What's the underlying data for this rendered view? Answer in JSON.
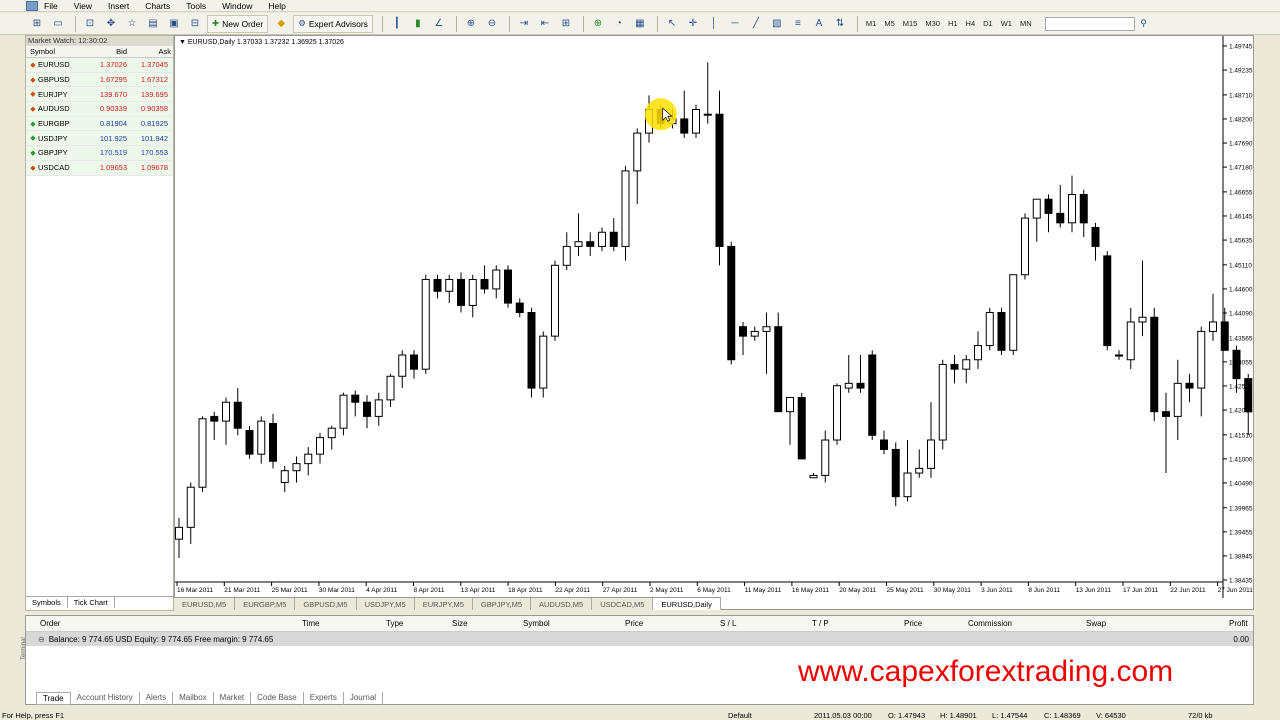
{
  "menu": [
    "File",
    "View",
    "Insert",
    "Charts",
    "Tools",
    "Window",
    "Help"
  ],
  "toolbar": {
    "new_order": "New Order",
    "expert_advisors": "Expert Advisors",
    "timeframes": [
      "M1",
      "M5",
      "M15",
      "M30",
      "H1",
      "H4",
      "D1",
      "W1",
      "MN"
    ]
  },
  "market_watch": {
    "title": "Market Watch: 12:30:02",
    "headers": {
      "symbol": "Symbol",
      "bid": "Bid",
      "ask": "Ask"
    },
    "rows": [
      {
        "symbol": "EURUSD",
        "bid": "1.37026",
        "ask": "1.37045",
        "dir": "down",
        "color": "#c81e1e"
      },
      {
        "symbol": "GBPUSD",
        "bid": "1.67295",
        "ask": "1.67312",
        "dir": "down",
        "color": "#c81e1e"
      },
      {
        "symbol": "EURJPY",
        "bid": "139.670",
        "ask": "139.695",
        "dir": "down",
        "color": "#c81e1e"
      },
      {
        "symbol": "AUDUSD",
        "bid": "0.90339",
        "ask": "0.90358",
        "dir": "down",
        "color": "#c81e1e"
      },
      {
        "symbol": "EURGBP",
        "bid": "0.81904",
        "ask": "0.81925",
        "dir": "up",
        "color": "#1a3fa8"
      },
      {
        "symbol": "USDJPY",
        "bid": "101.925",
        "ask": "101.942",
        "dir": "up",
        "color": "#1a3fa8"
      },
      {
        "symbol": "GBPJPY",
        "bid": "170.519",
        "ask": "170.553",
        "dir": "up",
        "color": "#1a3fa8"
      },
      {
        "symbol": "USDCAD",
        "bid": "1.09653",
        "ask": "1.09678",
        "dir": "down",
        "color": "#c81e1e"
      }
    ],
    "tabs": [
      "Symbols",
      "Tick Chart"
    ]
  },
  "chart": {
    "title": "EURUSD,Daily  1.37033 1.37232 1.36925 1.37026",
    "price_labels": [
      "1.49745",
      "1.49235",
      "1.48710",
      "1.48200",
      "1.47690",
      "1.47180",
      "1.46655",
      "1.46145",
      "1.45635",
      "1.45110",
      "1.44600",
      "1.44090",
      "1.43565",
      "1.43055",
      "1.42545",
      "1.42035",
      "1.41510",
      "1.41000",
      "1.40490",
      "1.39965",
      "1.39455",
      "1.38945",
      "1.38435"
    ],
    "date_labels": [
      "16 Mar 2011",
      "21 Mar 2011",
      "25 Mar 2011",
      "30 Mar 2011",
      "4 Apr 2011",
      "8 Apr 2011",
      "13 Apr 2011",
      "18 Apr 2011",
      "22 Apr 2011",
      "27 Apr 2011",
      "2 May 2011",
      "6 May 2011",
      "11 May 2011",
      "16 May 2011",
      "20 May 2011",
      "25 May 2011",
      "30 May 2011",
      "3 Jun 2011",
      "8 Jun 2011",
      "13 Jun 2011",
      "17 Jun 2011",
      "22 Jun 2011",
      "27 Jun 2011"
    ],
    "tabs": [
      "EURUSD,M5",
      "EURGBP,M5",
      "GBPUSD,M5",
      "USDJPY,M5",
      "EURJPY,M5",
      "GBPJPY,M5",
      "AUDUSD,M5",
      "USDCAD,M5",
      "EURUSD,Daily"
    ]
  },
  "chart_data": {
    "type": "candlestick",
    "symbol": "EURUSD",
    "ylim": [
      1.38435,
      1.49745
    ],
    "candles": [
      [
        1.393,
        1.3975,
        1.389,
        1.3955
      ],
      [
        1.3955,
        1.405,
        1.392,
        1.404
      ],
      [
        1.404,
        1.419,
        1.403,
        1.4185
      ],
      [
        1.419,
        1.42,
        1.414,
        1.418
      ],
      [
        1.418,
        1.423,
        1.413,
        1.422
      ],
      [
        1.422,
        1.425,
        1.415,
        1.4165
      ],
      [
        1.416,
        1.417,
        1.41,
        1.411
      ],
      [
        1.411,
        1.419,
        1.409,
        1.418
      ],
      [
        1.4175,
        1.4195,
        1.408,
        1.4095
      ],
      [
        1.405,
        1.4085,
        1.403,
        1.4075
      ],
      [
        1.4075,
        1.4105,
        1.405,
        1.409
      ],
      [
        1.409,
        1.4125,
        1.4065,
        1.411
      ],
      [
        1.411,
        1.4155,
        1.409,
        1.4145
      ],
      [
        1.4145,
        1.417,
        1.412,
        1.4165
      ],
      [
        1.4165,
        1.424,
        1.415,
        1.4235
      ],
      [
        1.4235,
        1.4245,
        1.419,
        1.422
      ],
      [
        1.422,
        1.4235,
        1.4165,
        1.419
      ],
      [
        1.419,
        1.424,
        1.417,
        1.4225
      ],
      [
        1.4225,
        1.428,
        1.421,
        1.4275
      ],
      [
        1.4275,
        1.433,
        1.425,
        1.432
      ],
      [
        1.432,
        1.433,
        1.427,
        1.429
      ],
      [
        1.429,
        1.449,
        1.428,
        1.448
      ],
      [
        1.448,
        1.449,
        1.444,
        1.4455
      ],
      [
        1.4455,
        1.449,
        1.443,
        1.448
      ],
      [
        1.448,
        1.4495,
        1.441,
        1.4425
      ],
      [
        1.4425,
        1.449,
        1.44,
        1.448
      ],
      [
        1.448,
        1.451,
        1.445,
        1.446
      ],
      [
        1.446,
        1.451,
        1.444,
        1.45
      ],
      [
        1.45,
        1.451,
        1.442,
        1.443
      ],
      [
        1.443,
        1.444,
        1.44,
        1.441
      ],
      [
        1.441,
        1.442,
        1.423,
        1.425
      ],
      [
        1.425,
        1.437,
        1.423,
        1.436
      ],
      [
        1.436,
        1.452,
        1.435,
        1.451
      ],
      [
        1.451,
        1.458,
        1.45,
        1.455
      ],
      [
        1.455,
        1.462,
        1.453,
        1.456
      ],
      [
        1.456,
        1.458,
        1.453,
        1.455
      ],
      [
        1.455,
        1.459,
        1.454,
        1.458
      ],
      [
        1.458,
        1.461,
        1.454,
        1.455
      ],
      [
        1.455,
        1.472,
        1.452,
        1.471
      ],
      [
        1.471,
        1.48,
        1.464,
        1.479
      ],
      [
        1.479,
        1.487,
        1.477,
        1.484
      ],
      [
        1.484,
        1.485,
        1.48,
        1.481
      ],
      [
        1.481,
        1.484,
        1.48,
        1.482
      ],
      [
        1.482,
        1.488,
        1.478,
        1.479
      ],
      [
        1.479,
        1.485,
        1.478,
        1.484
      ],
      [
        1.483,
        1.494,
        1.481,
        1.483
      ],
      [
        1.483,
        1.488,
        1.451,
        1.455
      ],
      [
        1.455,
        1.456,
        1.43,
        1.431
      ],
      [
        1.438,
        1.439,
        1.432,
        1.436
      ],
      [
        1.436,
        1.438,
        1.435,
        1.437
      ],
      [
        1.437,
        1.441,
        1.428,
        1.438
      ],
      [
        1.438,
        1.441,
        1.42,
        1.42
      ],
      [
        1.42,
        1.423,
        1.413,
        1.423
      ],
      [
        1.423,
        1.424,
        1.41,
        1.41
      ],
      [
        1.406,
        1.407,
        1.406,
        1.4065
      ],
      [
        1.4065,
        1.416,
        1.405,
        1.414
      ],
      [
        1.414,
        1.426,
        1.413,
        1.4255
      ],
      [
        1.425,
        1.432,
        1.424,
        1.426
      ],
      [
        1.426,
        1.432,
        1.424,
        1.425
      ],
      [
        1.432,
        1.433,
        1.414,
        1.415
      ],
      [
        1.414,
        1.416,
        1.411,
        1.412
      ],
      [
        1.412,
        1.4135,
        1.4,
        1.402
      ],
      [
        1.402,
        1.414,
        1.401,
        1.407
      ],
      [
        1.407,
        1.412,
        1.406,
        1.408
      ],
      [
        1.408,
        1.422,
        1.406,
        1.414
      ],
      [
        1.414,
        1.431,
        1.412,
        1.43
      ],
      [
        1.43,
        1.432,
        1.426,
        1.429
      ],
      [
        1.429,
        1.432,
        1.426,
        1.431
      ],
      [
        1.431,
        1.437,
        1.429,
        1.434
      ],
      [
        1.434,
        1.442,
        1.433,
        1.441
      ],
      [
        1.441,
        1.442,
        1.432,
        1.433
      ],
      [
        1.433,
        1.449,
        1.432,
        1.449
      ],
      [
        1.449,
        1.462,
        1.448,
        1.461
      ],
      [
        1.461,
        1.465,
        1.456,
        1.465
      ],
      [
        1.465,
        1.466,
        1.458,
        1.462
      ],
      [
        1.462,
        1.468,
        1.459,
        1.46
      ],
      [
        1.46,
        1.47,
        1.458,
        1.466
      ],
      [
        1.466,
        1.467,
        1.457,
        1.46
      ],
      [
        1.459,
        1.46,
        1.452,
        1.455
      ],
      [
        1.453,
        1.454,
        1.433,
        1.434
      ],
      [
        1.432,
        1.433,
        1.431,
        1.432
      ],
      [
        1.431,
        1.442,
        1.429,
        1.439
      ],
      [
        1.439,
        1.452,
        1.436,
        1.44
      ],
      [
        1.44,
        1.442,
        1.418,
        1.42
      ],
      [
        1.42,
        1.424,
        1.407,
        1.419
      ],
      [
        1.419,
        1.431,
        1.414,
        1.426
      ],
      [
        1.426,
        1.428,
        1.422,
        1.425
      ],
      [
        1.425,
        1.438,
        1.419,
        1.437
      ],
      [
        1.437,
        1.445,
        1.435,
        1.439
      ],
      [
        1.439,
        1.442,
        1.433,
        1.433
      ],
      [
        1.433,
        1.434,
        1.424,
        1.427
      ],
      [
        1.427,
        1.428,
        1.415,
        1.42
      ],
      [
        1.42,
        1.425,
        1.415,
        1.416
      ],
      [
        1.416,
        1.433,
        1.414,
        1.431
      ],
      [
        1.431,
        1.433,
        1.427,
        1.43
      ]
    ]
  },
  "annotation": {
    "highlight_color": "#ffe100"
  },
  "terminal": {
    "headers": [
      "Order",
      "Time",
      "Type",
      "Size",
      "Symbol",
      "Price",
      "S / L",
      "T / P",
      "Price",
      "Commission",
      "Swap",
      "Profit"
    ],
    "balance": "Balance: 9 774.65 USD  Equity: 9 774.65  Free margin: 9 774.65",
    "profit": "0.00",
    "side_label": "Terminal",
    "tabs": [
      "Trade",
      "Account History",
      "Alerts",
      "Mailbox",
      "Market",
      "Code Base",
      "Experts",
      "Journal"
    ]
  },
  "watermark": "www.capexforextrading.com",
  "status": {
    "help": "For Help, press F1",
    "profile": "Default",
    "time": "2011.05.03 00:00",
    "o": "O: 1.47943",
    "h": "H: 1.48901",
    "l": "L: 1.47544",
    "c": "C: 1.48369",
    "v": "V: 64530",
    "size": "72/0 kb"
  }
}
